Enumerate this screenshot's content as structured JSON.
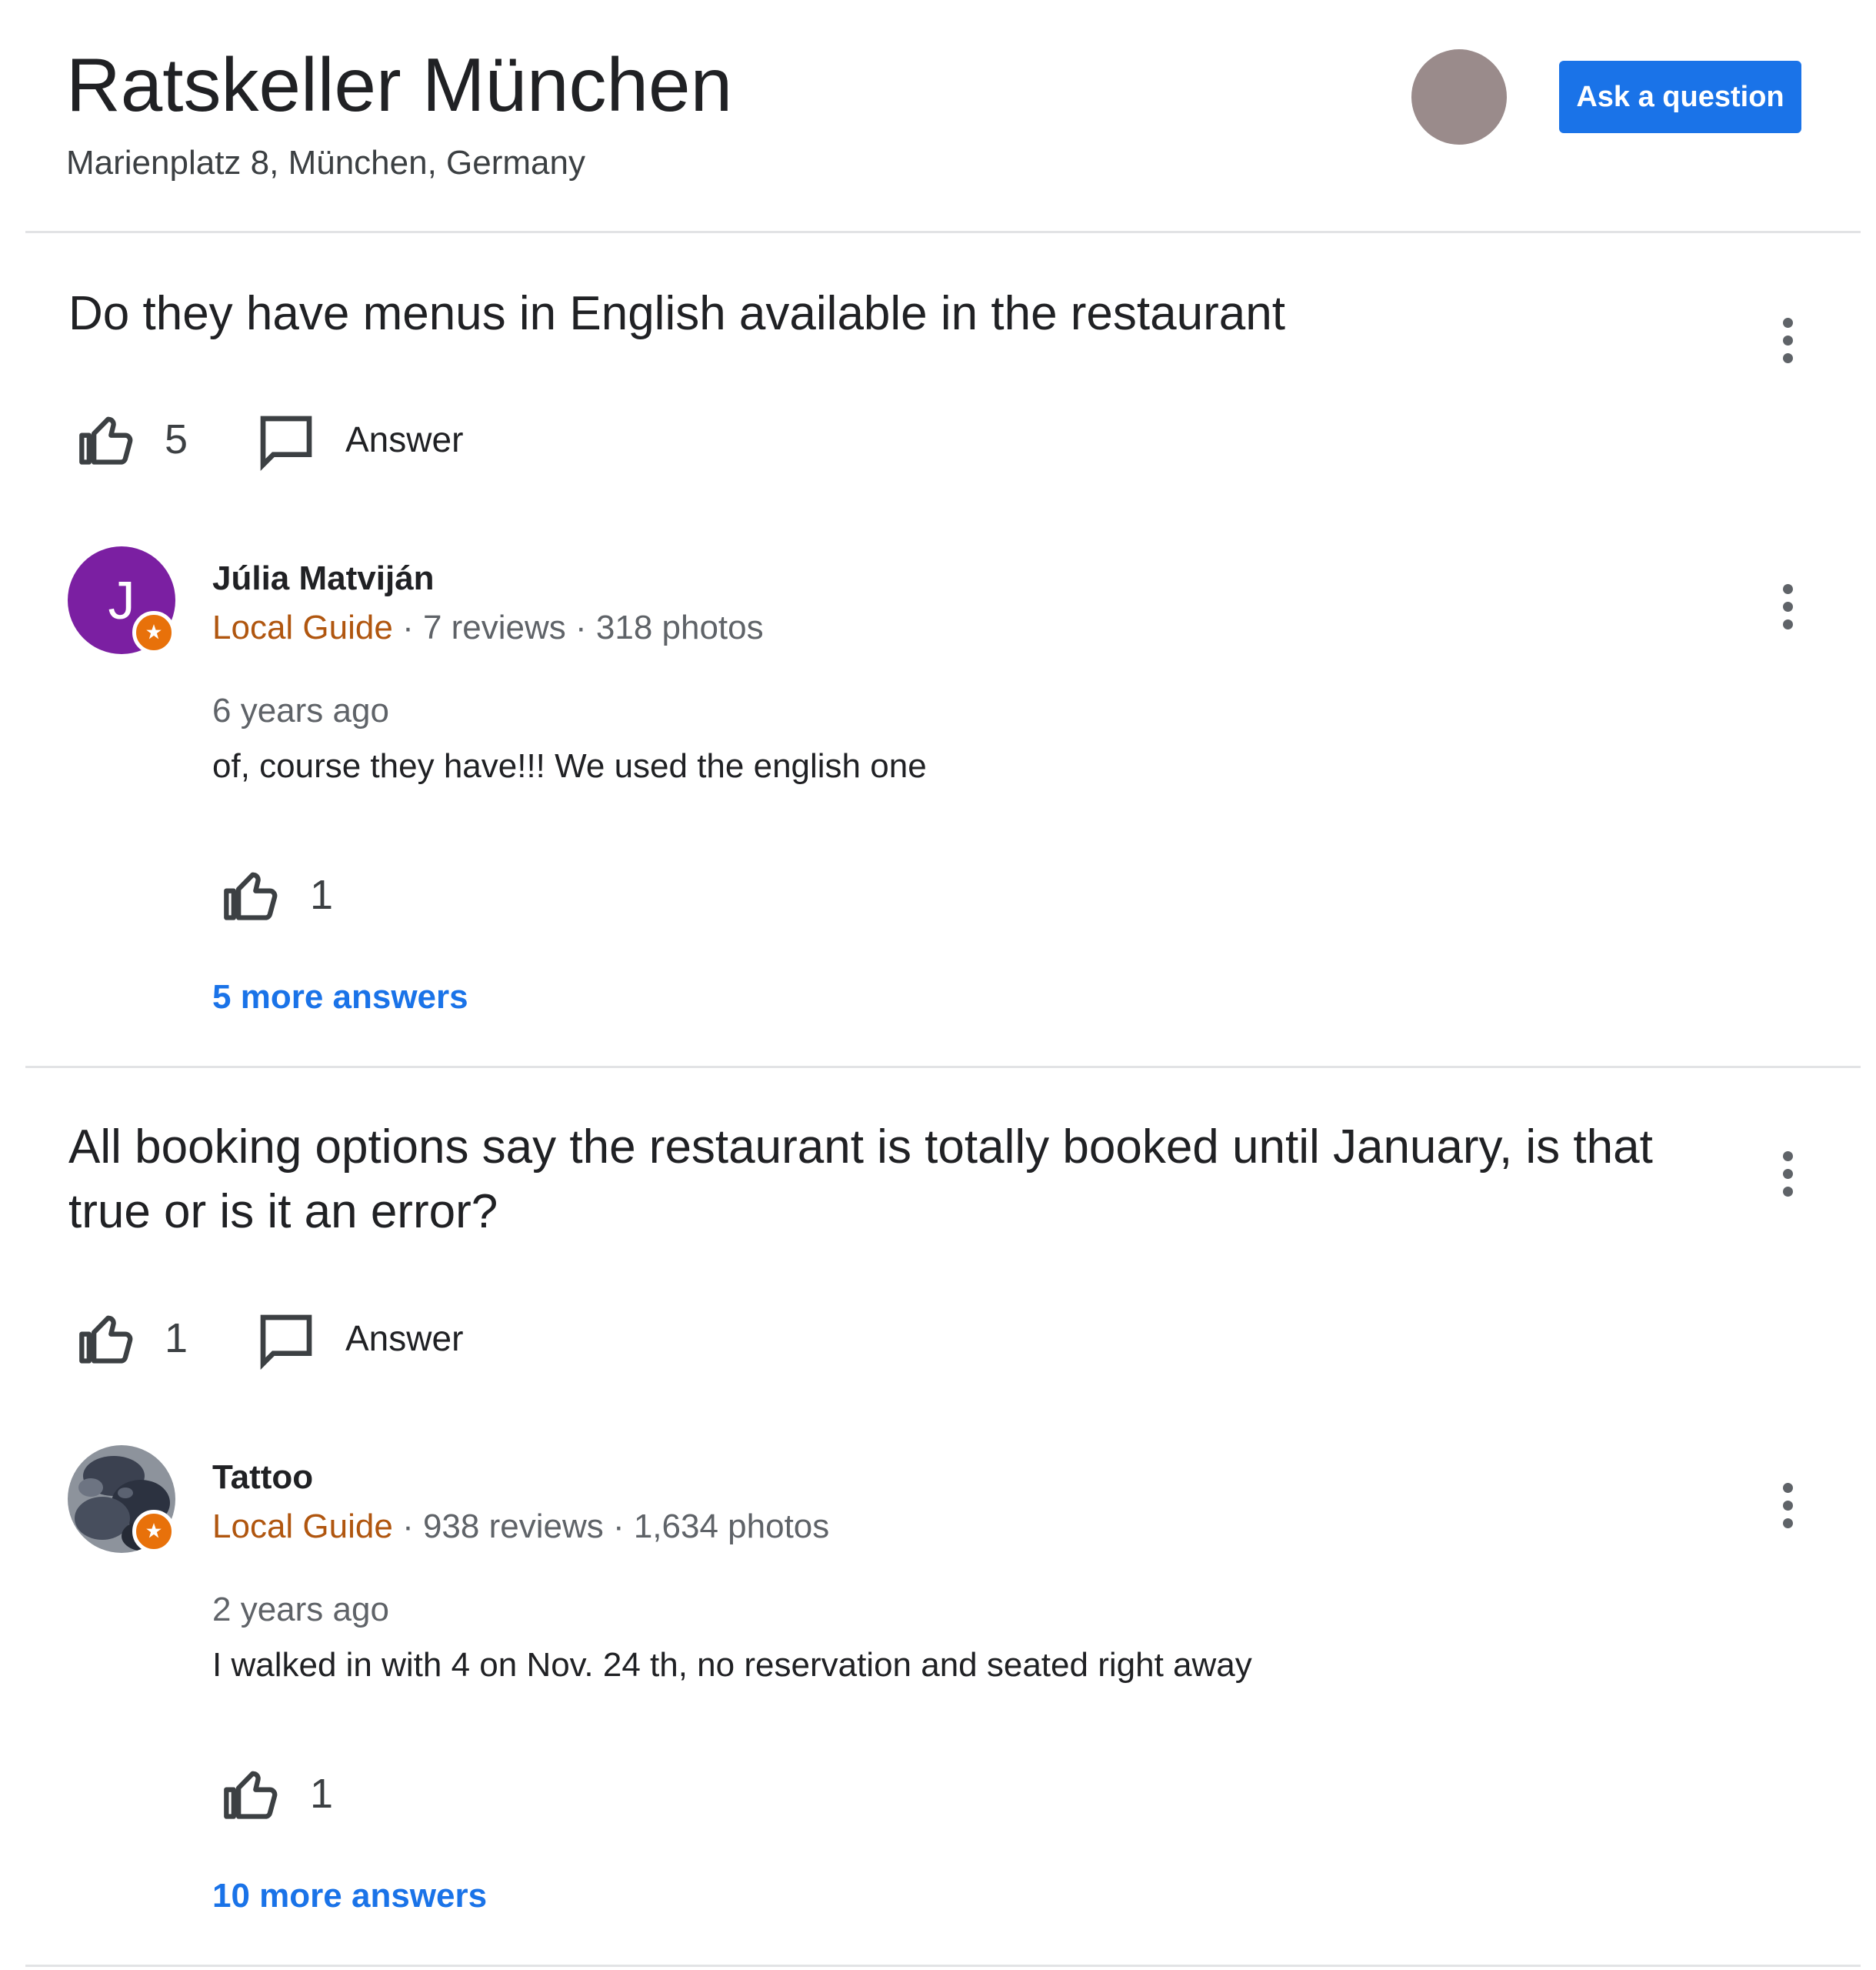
{
  "header": {
    "title": "Ratskeller München",
    "address": "Marienplatz 8, München, Germany",
    "ask_button": "Ask a question"
  },
  "questions": [
    {
      "text": "Do they have menus in English available in the restaurant",
      "likes": "5",
      "answer_label": "Answer",
      "answer": {
        "author": "Júlia Matviján",
        "avatar_letter": "J",
        "badge": "Local Guide",
        "stats": "· 7 reviews · 318 photos",
        "time": "6 years ago",
        "text": "of, course they have!!! We used the english one",
        "likes": "1"
      },
      "more_answers": "5 more answers"
    },
    {
      "text": "All booking options say the restaurant is totally booked until January, is that true or is it an error?",
      "likes": "1",
      "answer_label": "Answer",
      "answer": {
        "author": "Tattoo",
        "badge": "Local Guide",
        "stats": "· 938 reviews · 1,634 photos",
        "time": "2 years ago",
        "text": "I walked in with 4 on Nov. 24 th, no reservation and seated right away",
        "likes": "1"
      },
      "more_answers": "10 more answers"
    }
  ],
  "colors": {
    "accent_blue": "#1a73e8",
    "local_guide": "#b0560f",
    "badge_orange": "#e8710a",
    "avatar_purple": "#7b1fa2",
    "user_avatar": "#9a8b8b"
  },
  "icons": {
    "like": "thumb-up-icon",
    "answer": "comment-icon",
    "more": "more-vert-icon",
    "badge": "local-guide-star-icon"
  }
}
